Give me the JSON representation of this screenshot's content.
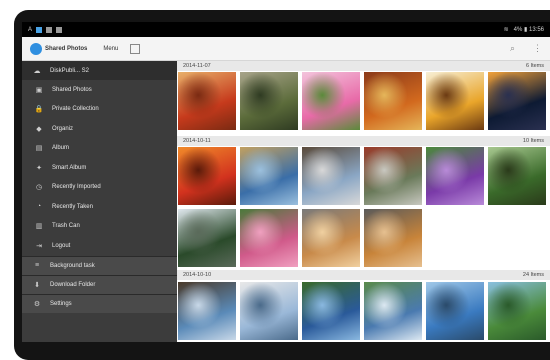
{
  "statusbar": {
    "left_glyph": "A",
    "right_text": "4% ▮ 13:56"
  },
  "appbar": {
    "app_title": "Shared Photos",
    "menu_label": "Menu",
    "search_icon": "search-icon",
    "more_icon": "more-vert-icon"
  },
  "sidebar": {
    "root": {
      "label": "DiskPubli... S2",
      "icon": "cloud-icon"
    },
    "items": [
      {
        "label": "Shared Photos",
        "icon": "photo-icon"
      },
      {
        "label": "Private Collection",
        "icon": "lock-icon"
      },
      {
        "label": "Organiz",
        "icon": "folder-icon"
      },
      {
        "label": "Album",
        "icon": "album-icon"
      },
      {
        "label": "Smart Album",
        "icon": "smart-album-icon"
      },
      {
        "label": "Recently Imported",
        "icon": "import-icon"
      },
      {
        "label": "Recently Taken",
        "icon": "clock-icon"
      },
      {
        "label": "Trash Can",
        "icon": "trash-icon"
      },
      {
        "label": "Logout",
        "icon": "logout-icon"
      }
    ],
    "sections": [
      {
        "label": "Background task",
        "icon": "task-icon"
      },
      {
        "label": "Download Folder",
        "icon": "download-icon"
      },
      {
        "label": "Settings",
        "icon": "gear-icon"
      }
    ]
  },
  "groups": [
    {
      "date": "2014-11-07",
      "count": "6 Items",
      "photos": [
        "red-autumn-leaves",
        "buddha-statue",
        "pink-flowers",
        "autumn-tree",
        "beer-glass",
        "night-tower"
      ]
    },
    {
      "date": "2014-10-11",
      "count": "10 Items",
      "photos": [
        "red-maple",
        "lake-statue",
        "japanese-house",
        "shrine-gate",
        "purple-flowers",
        "green-tree",
        "pine-tree",
        "pink-garden-flowers",
        "shiba-dog",
        "shiba-dog-sitting"
      ]
    },
    {
      "date": "2014-10-10",
      "count": "24 Items",
      "photos": [
        "sea-bare-tree",
        "ferry-boat",
        "island-sea",
        "island-coast",
        "blue-lake",
        "green-hill"
      ]
    }
  ],
  "colors": {
    "accent": "#2f8fe0",
    "sidebar": "#3c3c3c",
    "header": "#e8e8e8"
  }
}
